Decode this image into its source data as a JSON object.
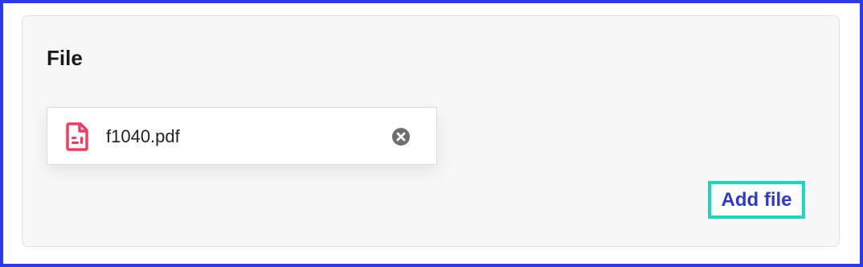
{
  "section": {
    "title": "File"
  },
  "file": {
    "name": "f1040.pdf",
    "icon": "pdf-document-icon",
    "icon_color": "#f03a5f",
    "remove_icon": "close-circle-icon"
  },
  "actions": {
    "add_file_label": "Add file"
  },
  "colors": {
    "frame_border": "#2b3aed",
    "focus_outline": "#19d9bd",
    "link": "#2e38d8"
  }
}
